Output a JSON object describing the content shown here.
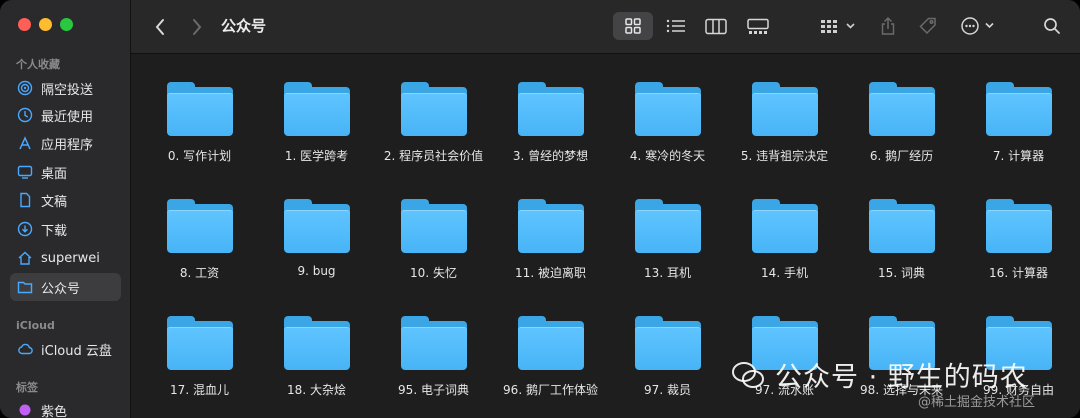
{
  "window": {
    "title": "公众号"
  },
  "sidebar": {
    "sections": [
      {
        "title": "个人收藏"
      },
      {
        "title": "iCloud"
      },
      {
        "title": "标签"
      }
    ],
    "favorites": [
      {
        "label": "隔空投送",
        "icon": "airdrop-icon"
      },
      {
        "label": "最近使用",
        "icon": "clock-icon"
      },
      {
        "label": "应用程序",
        "icon": "applications-icon"
      },
      {
        "label": "桌面",
        "icon": "desktop-icon"
      },
      {
        "label": "文稿",
        "icon": "document-icon"
      },
      {
        "label": "下载",
        "icon": "download-icon"
      },
      {
        "label": "superwei",
        "icon": "home-icon"
      },
      {
        "label": "公众号",
        "icon": "folder-icon",
        "selected": true
      }
    ],
    "icloud": [
      {
        "label": "iCloud 云盘",
        "icon": "cloud-icon"
      }
    ],
    "tags": [
      {
        "label": "紫色",
        "color": "#c061f4"
      }
    ]
  },
  "folders": [
    "0. 写作计划",
    "1. 医学跨考",
    "2. 程序员社会价值",
    "3. 曾经的梦想",
    "4. 寒冷的冬天",
    "5. 违背祖宗决定",
    "6. 鹅厂经历",
    "7. 计算器",
    "8. 工资",
    "9. bug",
    "10. 失忆",
    "11. 被迫离职",
    "13. 耳机",
    "14. 手机",
    "15. 词典",
    "16. 计算器",
    "17. 混血儿",
    "18. 大杂烩",
    "95. 电子词典",
    "96. 鹅厂工作体验",
    "97. 裁员",
    "97. 流水账",
    "98. 选择与未来",
    "99. 财务自由"
  ],
  "watermark": {
    "text": "公众号 · 野生的码农",
    "sub": "@稀土掘金技术社区"
  },
  "colors": {
    "folder": "#4cb8fa",
    "accent": "#3aa6e6",
    "tag_purple": "#c061f4"
  }
}
